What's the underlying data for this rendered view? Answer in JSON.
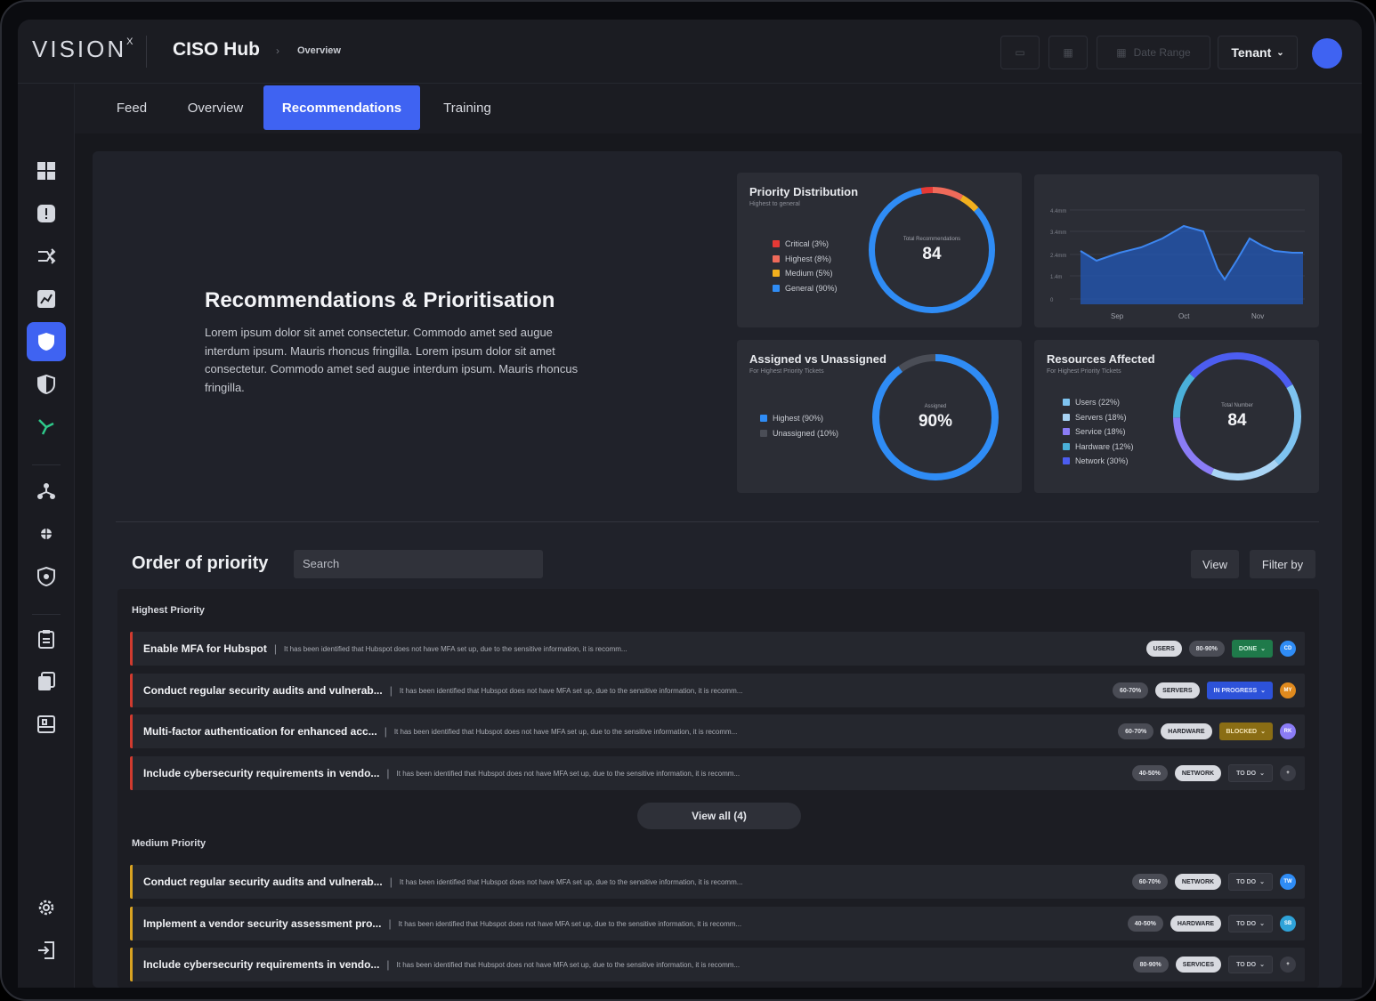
{
  "header": {
    "logo": "VISION",
    "logo_mark": "X",
    "hub_title": "CISO Hub",
    "breadcrumb": "Overview",
    "date_range": "Date Range",
    "tenant": "Tenant"
  },
  "tabs": [
    {
      "label": "Feed"
    },
    {
      "label": "Overview"
    },
    {
      "label": "Recommendations",
      "active": true
    },
    {
      "label": "Training"
    }
  ],
  "sidebar_icons": [
    "dashboard-icon",
    "alert-icon",
    "shuffle-icon",
    "report-icon",
    "shield-icon",
    "half-shield-icon",
    "route-icon",
    "hierarchy-icon",
    "bug-icon",
    "lock-shield-icon",
    "clipboard-icon",
    "documents-icon",
    "scan-icon",
    "settings-icon",
    "logout-icon"
  ],
  "hero": {
    "title": "Recommendations & Prioritisation",
    "description": "Lorem ipsum dolor sit amet consectetur. Commodo amet sed augue interdum ipsum. Mauris rhoncus fringilla. Lorem ipsum dolor sit amet consectetur. Commodo amet sed augue interdum ipsum. Mauris rhoncus fringilla."
  },
  "priority_card": {
    "title": "Priority Distribution",
    "subtitle": "Highest to general",
    "center_label": "Total Recommendations",
    "center_value": "84",
    "legend": [
      {
        "label": "Critical (3%)",
        "color": "#e53935",
        "value": 3
      },
      {
        "label": "Highest (8%)",
        "color": "#ef6a5a",
        "value": 8
      },
      {
        "label": "Medium (5%)",
        "color": "#f2b01e",
        "value": 5
      },
      {
        "label": "General (90%)",
        "color": "#2f8cf5",
        "value": 84
      }
    ]
  },
  "trend_card": {
    "y_ticks": [
      "4.4mm",
      "3.4mm",
      "2.4mm",
      "1.4m",
      "0"
    ],
    "x_ticks": [
      "Sep",
      "Oct",
      "Nov"
    ]
  },
  "assigned_card": {
    "title": "Assigned vs Unassigned",
    "subtitle": "For Highest Priority Tickets",
    "center_label": "Assigned",
    "center_value": "90%",
    "legend": [
      {
        "label": "Highest (90%)",
        "color": "#2f8cf5",
        "value": 90
      },
      {
        "label": "Unassigned (10%)",
        "color": "#4a4d56",
        "value": 10
      }
    ]
  },
  "resources_card": {
    "title": "Resources Affected",
    "subtitle": "For Highest Priority Tickets",
    "center_label": "Total Number",
    "center_value": "84",
    "legend": [
      {
        "label": "Users (22%)",
        "color": "#7ec3f0",
        "value": 22
      },
      {
        "label": "Servers (18%)",
        "color": "#a9d4f4",
        "value": 18
      },
      {
        "label": "Service (18%)",
        "color": "#8b7cf6",
        "value": 18
      },
      {
        "label": "Hardware (12%)",
        "color": "#4ab0d9",
        "value": 12
      },
      {
        "label": "Network (30%)",
        "color": "#4c5df0",
        "value": 30
      }
    ]
  },
  "priority_list": {
    "title": "Order of priority",
    "search_placeholder": "Search",
    "view_label": "View",
    "filter_label": "Filter by",
    "view_all_label": "View all (4)",
    "groups": [
      {
        "label": "Highest Priority",
        "rows": [
          {
            "title": "Enable MFA for Hubspot",
            "desc": "It has been identified that Hubspot does not have MFA set up, due to the sensitive information, it is recomm...",
            "chips": [
              {
                "text": "USERS",
                "style": "light"
              },
              {
                "text": "80-90%",
                "style": "dark"
              }
            ],
            "status": "DONE",
            "status_style": "st-done",
            "avatar": "CD",
            "avatar_color": "#2f8cf5"
          },
          {
            "title": "Conduct regular security audits and vulnerab...",
            "desc": "It has been identified that Hubspot does not have MFA set up, due to the sensitive information, it is recomm...",
            "chips": [
              {
                "text": "60-70%",
                "style": "dark"
              },
              {
                "text": "SERVERS",
                "style": "light"
              }
            ],
            "status": "IN PROGRESS",
            "status_style": "st-prog",
            "avatar": "MY",
            "avatar_color": "#e08a1e"
          },
          {
            "title": "Multi-factor authentication for enhanced acc...",
            "desc": "It has been identified that Hubspot does not have MFA set up, due to the sensitive information, it is recomm...",
            "chips": [
              {
                "text": "60-70%",
                "style": "dark"
              },
              {
                "text": "HARDWARE",
                "style": "light"
              }
            ],
            "status": "BLOCKED",
            "status_style": "st-block",
            "avatar": "RK",
            "avatar_color": "#8b7cf6"
          },
          {
            "title": "Include cybersecurity requirements in vendo...",
            "desc": "It has been identified that Hubspot does not have MFA set up, due to the sensitive information, it is recomm...",
            "chips": [
              {
                "text": "40-50%",
                "style": "dark"
              },
              {
                "text": "NETWORK",
                "style": "light"
              }
            ],
            "status": "TO DO",
            "status_style": "st-todo",
            "avatar": "+",
            "avatar_color": "#3a3c45"
          }
        ]
      },
      {
        "label": "Medium Priority",
        "rows": [
          {
            "title": "Conduct regular security audits and vulnerab...",
            "desc": "It has been identified that Hubspot does not have MFA set up, due to the sensitive information, it is recomm...",
            "chips": [
              {
                "text": "60-70%",
                "style": "dark"
              },
              {
                "text": "NETWORK",
                "style": "light"
              }
            ],
            "status": "TO DO",
            "status_style": "st-todo",
            "avatar": "TW",
            "avatar_color": "#2f8cf5"
          },
          {
            "title": "Implement a vendor security assessment pro...",
            "desc": "It has been identified that Hubspot does not have MFA set up, due to the sensitive information, it is recomm...",
            "chips": [
              {
                "text": "40-50%",
                "style": "dark"
              },
              {
                "text": "HARDWARE",
                "style": "light"
              }
            ],
            "status": "TO DO",
            "status_style": "st-todo",
            "avatar": "SB",
            "avatar_color": "#2fa3d9"
          },
          {
            "title": "Include cybersecurity requirements in vendo...",
            "desc": "It has been identified that Hubspot does not have MFA set up, due to the sensitive information, it is recomm...",
            "chips": [
              {
                "text": "80-90%",
                "style": "dark"
              },
              {
                "text": "SERVICES",
                "style": "light"
              }
            ],
            "status": "TO DO",
            "status_style": "st-todo",
            "avatar": "+",
            "avatar_color": "#3a3c45"
          }
        ]
      }
    ]
  }
}
